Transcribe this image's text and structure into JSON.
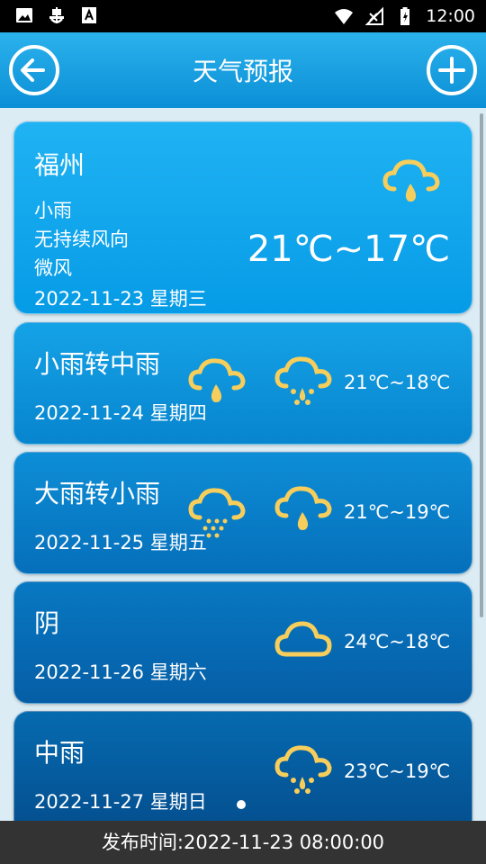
{
  "status_bar": {
    "time": "12:00"
  },
  "header": {
    "title": "天气预报",
    "back_icon": "arrow-left-icon",
    "add_icon": "plus-icon"
  },
  "today": {
    "city": "福州",
    "condition": "小雨",
    "wind_direction": "无持续风向",
    "wind_level": "微风",
    "date": "2022-11-23 星期三",
    "temp_range": "21℃~17℃",
    "icon": "light-rain-icon"
  },
  "forecast": [
    {
      "condition": "小雨转中雨",
      "date": "2022-11-24 星期四",
      "temp_range": "21℃~18℃",
      "icon_from": "light-rain-icon",
      "icon_to": "moderate-rain-icon"
    },
    {
      "condition": "大雨转小雨",
      "date": "2022-11-25 星期五",
      "temp_range": "21℃~19℃",
      "icon_from": "heavy-rain-icon",
      "icon_to": "light-rain-icon"
    },
    {
      "condition": "阴",
      "date": "2022-11-26 星期六",
      "temp_range": "24℃~18℃",
      "icon_to": "overcast-icon"
    },
    {
      "condition": "中雨",
      "date": "2022-11-27 星期日",
      "temp_range": "23℃~19℃",
      "icon_to": "moderate-rain-icon"
    }
  ],
  "footer": {
    "publish_time": "发布时间:2022-11-23 08:00:00"
  },
  "colors": {
    "icon_yellow": "#f7ce5b",
    "header_blue": "#0a8fd6",
    "footer_bg": "#333333"
  }
}
